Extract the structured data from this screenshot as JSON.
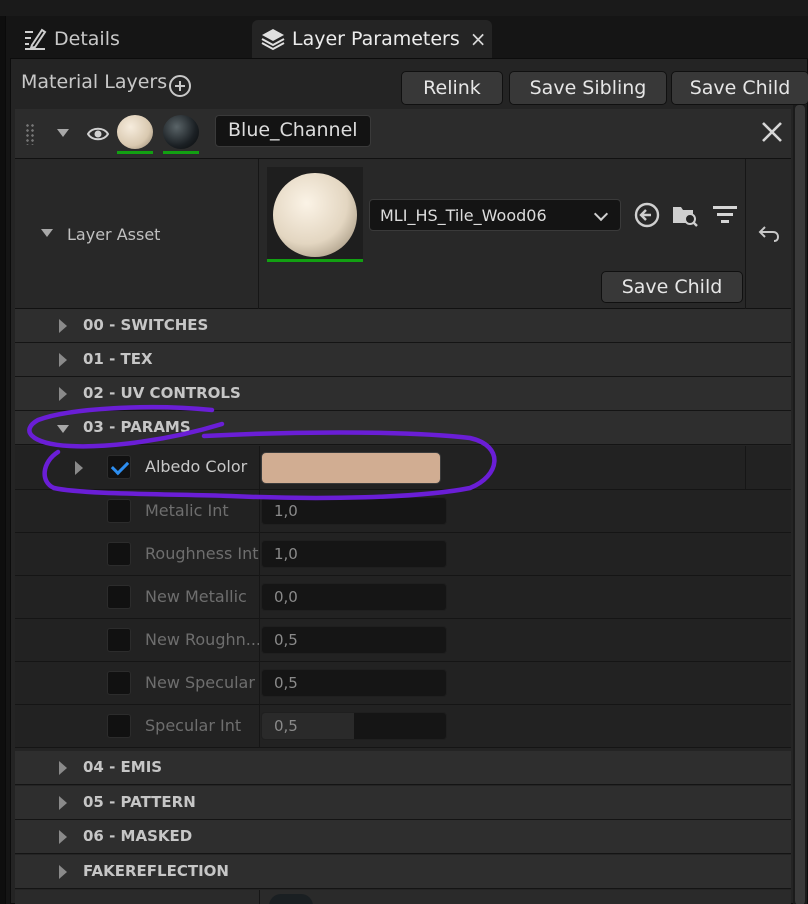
{
  "tabs": [
    {
      "label": "Details"
    },
    {
      "label": "Layer Parameters",
      "close": "×"
    }
  ],
  "toolbar": {
    "title": "Material Layers",
    "relink": "Relink",
    "save_sibling": "Save Sibling",
    "save_child": "Save Child"
  },
  "layer": {
    "name": "Blue_Channel"
  },
  "layer_asset": {
    "label": "Layer Asset",
    "asset": "MLI_HS_Tile_Wood06",
    "save_child": "Save Child"
  },
  "categories": {
    "c00": "00 - SWITCHES",
    "c01": "01 - TEX",
    "c02": "02 - UV CONTROLS",
    "c03": "03 - PARAMS",
    "c04": "04 - EMIS",
    "c05": "05 - PATTERN",
    "c06": "06 - MASKED",
    "c07": "FAKEREFLECTION"
  },
  "params": [
    {
      "label": "Albedo Color",
      "checked": true,
      "color": "#d1ad92"
    },
    {
      "label": "Metalic Int",
      "checked": false,
      "value": "1,0",
      "fill": 0
    },
    {
      "label": "Roughness Int",
      "checked": false,
      "value": "1,0",
      "fill": 0
    },
    {
      "label": "New Metallic",
      "checked": false,
      "value": "0,0",
      "fill": 0
    },
    {
      "label": "New Roughn...",
      "checked": false,
      "value": "0,5",
      "fill": 0
    },
    {
      "label": "New Specular",
      "checked": false,
      "value": "0,5",
      "fill": 0
    },
    {
      "label": "Specular Int",
      "checked": false,
      "value": "0,5",
      "fill": 0.5
    }
  ],
  "colors": {
    "annotation": "#6a1ed6",
    "accent_green": "#12a012",
    "check_blue": "#2d8ef0"
  }
}
